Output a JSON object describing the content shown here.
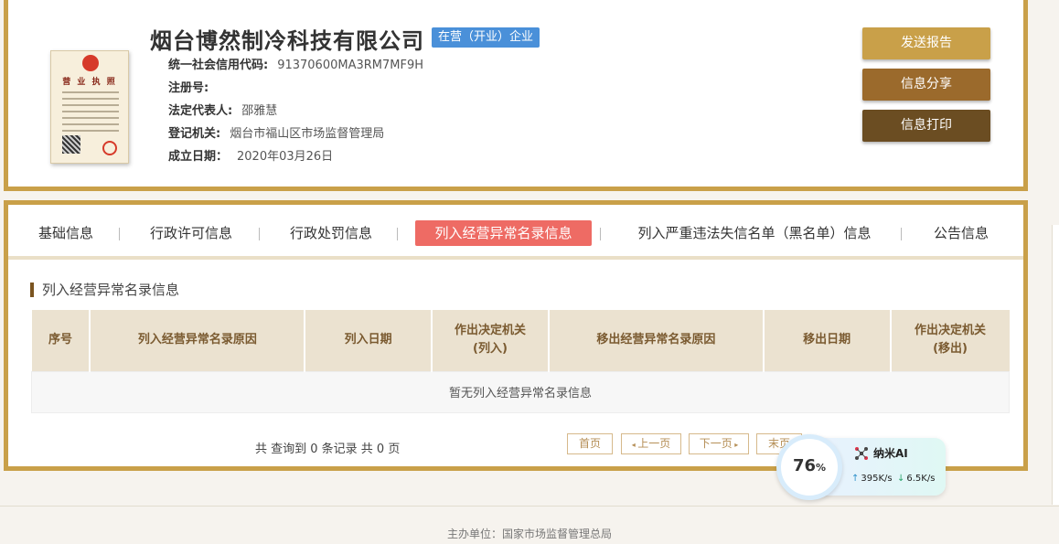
{
  "company": {
    "name": "烟台博然制冷科技有限公司",
    "status": "在营（开业）企业",
    "license_title": "营 业 执 照",
    "fields": [
      {
        "key": "统一社会信用代码:",
        "value": "91370600MA3RM7MF9H"
      },
      {
        "key": "注册号:",
        "value": ""
      },
      {
        "key": "法定代表人:",
        "value": "邵雅慧"
      },
      {
        "key": "登记机关:",
        "value": "烟台市福山区市场监督管理局"
      },
      {
        "key": "成立日期：",
        "value": "2020年03月26日"
      }
    ]
  },
  "actions": {
    "send_report": "发送报告",
    "share": "信息分享",
    "print": "信息打印"
  },
  "tabs": [
    {
      "label": "基础信息"
    },
    {
      "label": "行政许可信息"
    },
    {
      "label": "行政处罚信息"
    },
    {
      "label": "列入经营异常名录信息",
      "active": true
    },
    {
      "label": "列入严重违法失信名单（黑名单）信息"
    },
    {
      "label": "公告信息"
    }
  ],
  "section": {
    "title": "列入经营异常名录信息",
    "columns": [
      "序号",
      "列入经营异常名录原因",
      "列入日期",
      "作出决定机关\n(列入)",
      "移出经营异常名录原因",
      "移出日期",
      "作出决定机关\n(移出)"
    ],
    "empty_message": "暂无列入经营异常名录信息",
    "summary": "共 查询到 0 条记录 共 0 页"
  },
  "pager": {
    "first": "首页",
    "prev": "上一页",
    "next": "下一页",
    "last": "末页"
  },
  "footer": {
    "text": "主办单位：国家市场监督管理总局"
  },
  "widget": {
    "percent": "76",
    "percent_unit": "%",
    "app_name": "纳米AI",
    "upload": "395K/s",
    "download": "6.5K/s"
  }
}
